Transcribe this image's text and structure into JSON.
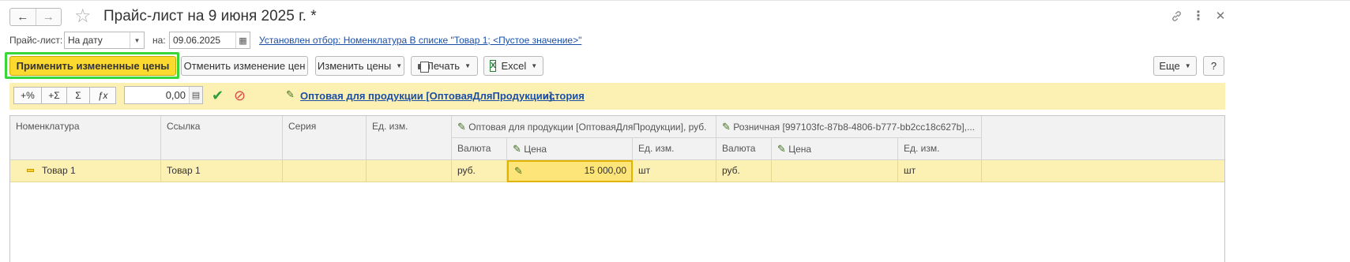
{
  "window": {
    "title": "Прайс-лист на 9 июня 2025 г. *",
    "icons": [
      "arrow-left-icon",
      "arrow-right-icon",
      "star-icon",
      "link-icon",
      "more-vertical-icon",
      "close-icon"
    ]
  },
  "filters": {
    "price_list_label": "Прайс-лист:",
    "price_list_value": "На дату",
    "date_label": "на:",
    "date_value": "09.06.2025",
    "selection_link": "Установлен отбор: Номенклатура В списке \"Товар 1; <Пустое значение>\""
  },
  "toolbar": {
    "apply_label": "Применить измененные цены",
    "cancel_label": "Отменить изменение цен",
    "change_prices_label": "Изменить цены",
    "print_label": "Печать",
    "excel_label": "Excel",
    "more_label": "Еще",
    "help_label": "?"
  },
  "edit_band": {
    "buttons": [
      "+%",
      "+Σ",
      "Σ",
      "ƒx"
    ],
    "amount_value": "0,00",
    "price_type_link": "Оптовая для продукции [ОптоваяДляПродукции],",
    "history_link": "история"
  },
  "table": {
    "columns": {
      "nomenclature": "Номенклатура",
      "ref": "Ссылка",
      "series": "Серия",
      "unit": "Ед. изм.",
      "wholesale_group": "Оптовая для продукции [ОптоваяДляПродукции], руб.",
      "retail_group": "Розничная [997103fc-87b8-4806-b777-bb2cc18c627b],...",
      "currency": "Валюта",
      "price": "Цена",
      "group_unit": "Ед. изм."
    },
    "rows": [
      {
        "nomenclature": "Товар 1",
        "ref": "Товар 1",
        "series": "",
        "unit": "",
        "wholesale_currency": "руб.",
        "wholesale_price": "15 000,00",
        "wholesale_unit": "шт",
        "retail_currency": "руб.",
        "retail_price": "",
        "retail_unit": "шт"
      }
    ]
  },
  "colors": {
    "primary_button": "#fcd92f",
    "focus_frame": "#39d639",
    "band_background": "#fdf0b3",
    "link": "#1a4fa8"
  }
}
